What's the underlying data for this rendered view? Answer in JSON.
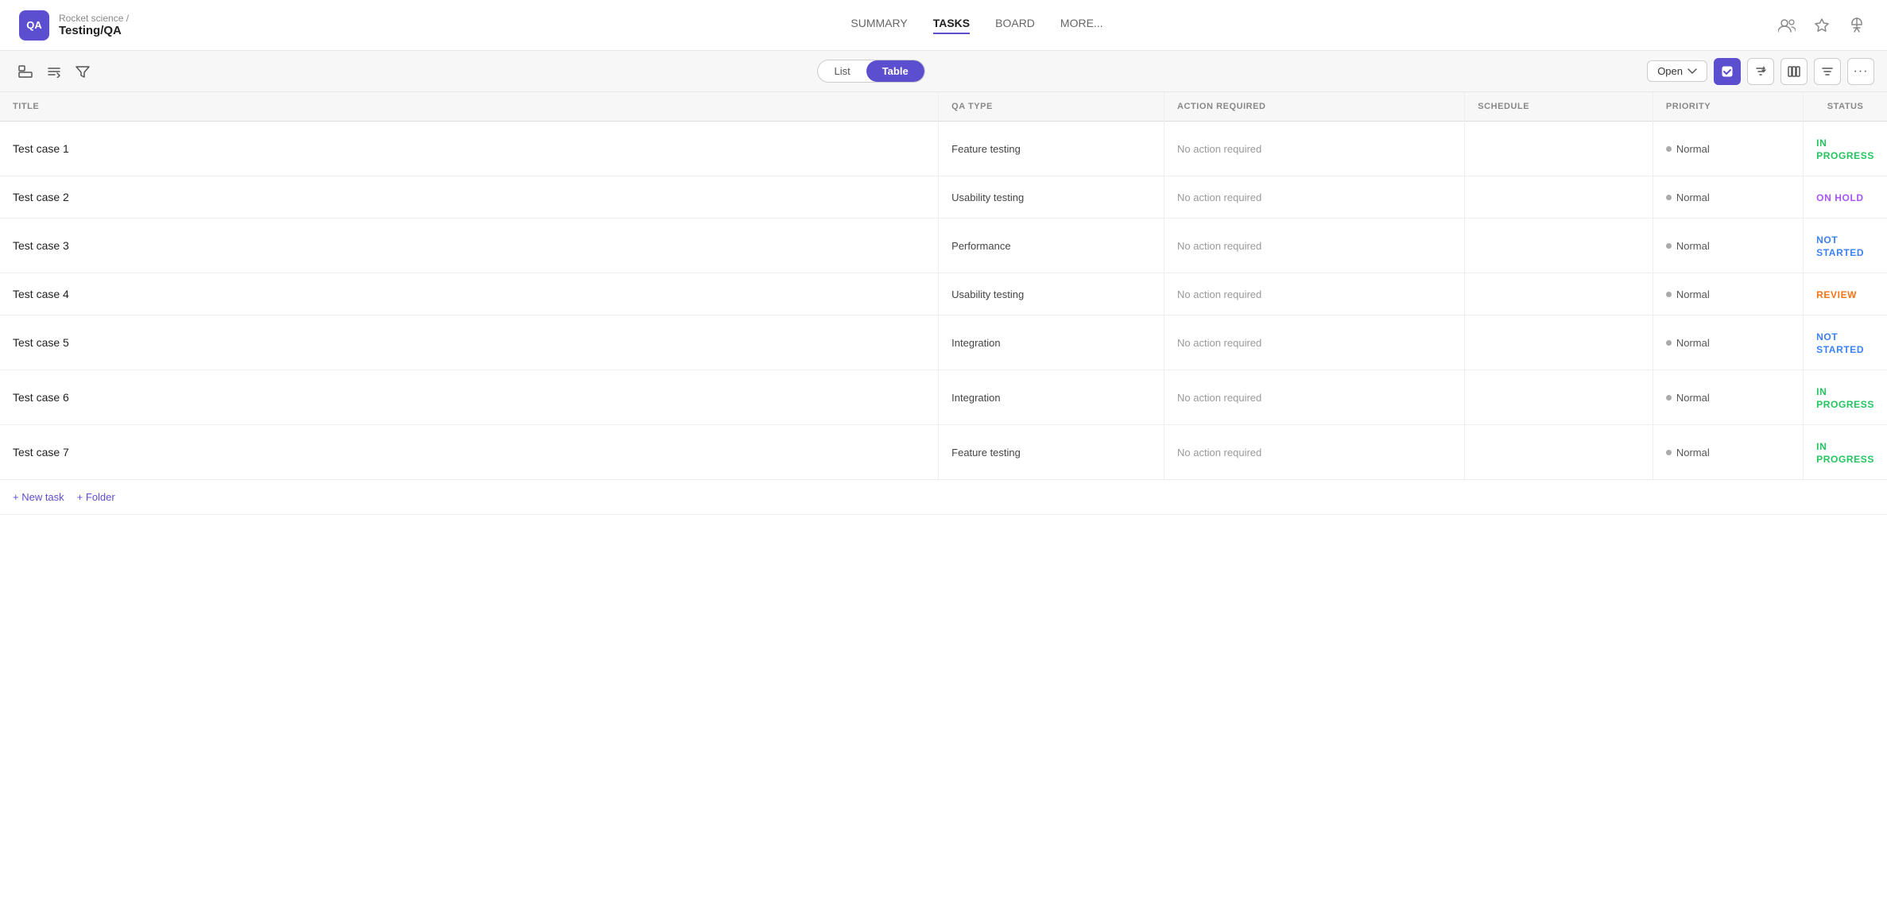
{
  "brand": {
    "icon": "QA",
    "parent": "Rocket science /",
    "name": "Testing/QA"
  },
  "nav": {
    "items": [
      {
        "label": "SUMMARY",
        "active": false
      },
      {
        "label": "TASKS",
        "active": true
      },
      {
        "label": "BOARD",
        "active": false
      },
      {
        "label": "MORE...",
        "active": false
      }
    ]
  },
  "toolbar": {
    "view_list": "List",
    "view_table": "Table",
    "open_label": "Open",
    "more_label": "···"
  },
  "table": {
    "columns": [
      "TITLE",
      "QA TYPE",
      "ACTION REQUIRED",
      "SCHEDULE",
      "PRIORITY",
      "STATUS"
    ],
    "rows": [
      {
        "title": "Test case 1",
        "qa_type": "Feature testing",
        "action": "No action required",
        "schedule": "",
        "priority": "Normal",
        "status": "IN PROGRESS",
        "status_class": "status-in-progress"
      },
      {
        "title": "Test case 2",
        "qa_type": "Usability testing",
        "action": "No action required",
        "schedule": "",
        "priority": "Normal",
        "status": "ON HOLD",
        "status_class": "status-on-hold"
      },
      {
        "title": "Test case 3",
        "qa_type": "Performance",
        "action": "No action required",
        "schedule": "",
        "priority": "Normal",
        "status": "NOT STARTED",
        "status_class": "status-not-started"
      },
      {
        "title": "Test case 4",
        "qa_type": "Usability testing",
        "action": "No action required",
        "schedule": "",
        "priority": "Normal",
        "status": "REVIEW",
        "status_class": "status-review"
      },
      {
        "title": "Test case 5",
        "qa_type": "Integration",
        "action": "No action required",
        "schedule": "",
        "priority": "Normal",
        "status": "NOT STARTED",
        "status_class": "status-not-started"
      },
      {
        "title": "Test case 6",
        "qa_type": "Integration",
        "action": "No action required",
        "schedule": "",
        "priority": "Normal",
        "status": "IN PROGRESS",
        "status_class": "status-in-progress"
      },
      {
        "title": "Test case 7",
        "qa_type": "Feature testing",
        "action": "No action required",
        "schedule": "",
        "priority": "Normal",
        "status": "IN PROGRESS",
        "status_class": "status-in-progress"
      }
    ],
    "add_task": "+ New task",
    "add_folder": "+ Folder"
  }
}
